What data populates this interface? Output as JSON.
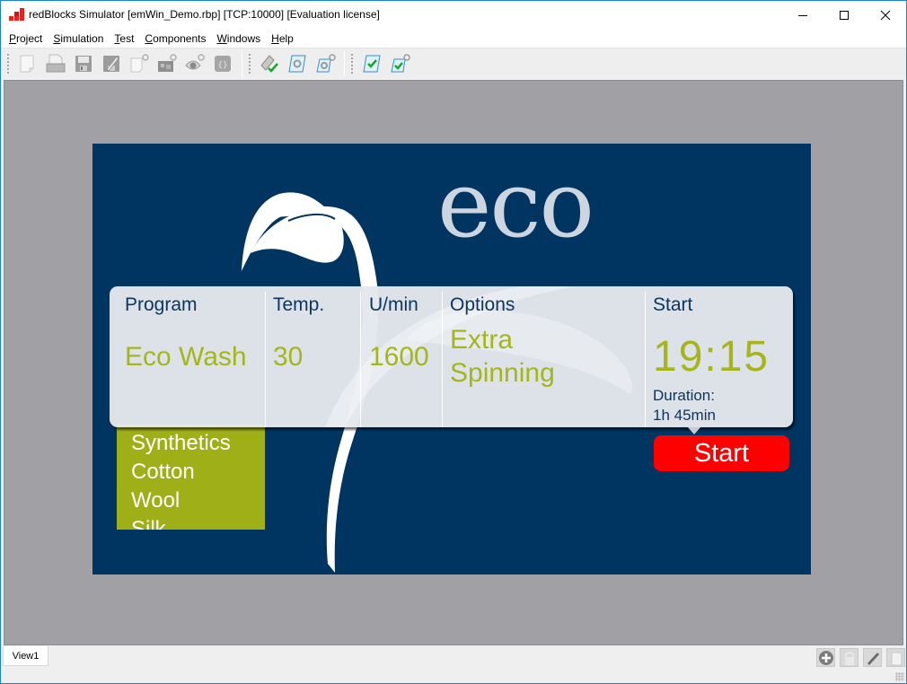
{
  "window": {
    "title": "redBlocks Simulator [emWin_Demo.rbp] [TCP:10000] [Evaluation license]",
    "controls": {
      "minimize": "minimize",
      "maximize": "maximize",
      "close": "close"
    }
  },
  "menu": [
    {
      "label": "Project",
      "accel": "P",
      "rest": "roject"
    },
    {
      "label": "Simulation",
      "accel": "S",
      "rest": "imulation"
    },
    {
      "label": "Test",
      "accel": "T",
      "rest": "est"
    },
    {
      "label": "Components",
      "accel": "C",
      "rest": "omponents"
    },
    {
      "label": "Windows",
      "accel": "W",
      "rest": "indows"
    },
    {
      "label": "Help",
      "accel": "H",
      "rest": "elp"
    }
  ],
  "toolbar": {
    "groups": [
      [
        "new-project-icon",
        "open-project-icon",
        "save-icon",
        "save-as-icon",
        "new-component-icon",
        "hardware-config-icon",
        "view-config-icon",
        "script-icon"
      ],
      [
        "build-check-icon",
        "settings-scroll-icon",
        "settings-scroll-tools-icon"
      ],
      [
        "test-check-icon",
        "test-check-tools-icon"
      ]
    ]
  },
  "device": {
    "logo": "eco",
    "panel": {
      "columns": [
        {
          "label": "Program",
          "value": "Eco Wash"
        },
        {
          "label": "Temp.",
          "value": "30"
        },
        {
          "label": "U/min",
          "value": "1600"
        },
        {
          "label": "Options",
          "value_line1": "Extra",
          "value_line2": "Spinning"
        },
        {
          "label": "Start",
          "value": "19:15",
          "duration_label": "Duration:",
          "duration_value": "1h 45min"
        }
      ]
    },
    "program_list": [
      "Synthetics",
      "Cotton",
      "Wool",
      "Silk"
    ],
    "start_button": "Start",
    "colors": {
      "background": "#003461",
      "accent_green": "#a6b51c",
      "list_green": "#9eaf18",
      "start_red": "#ff0000",
      "label_blue": "#0c3562"
    }
  },
  "bottom": {
    "tab": "View1",
    "buttons": [
      "add-icon",
      "lock-icon",
      "pencil-icon",
      "delete-icon"
    ]
  }
}
